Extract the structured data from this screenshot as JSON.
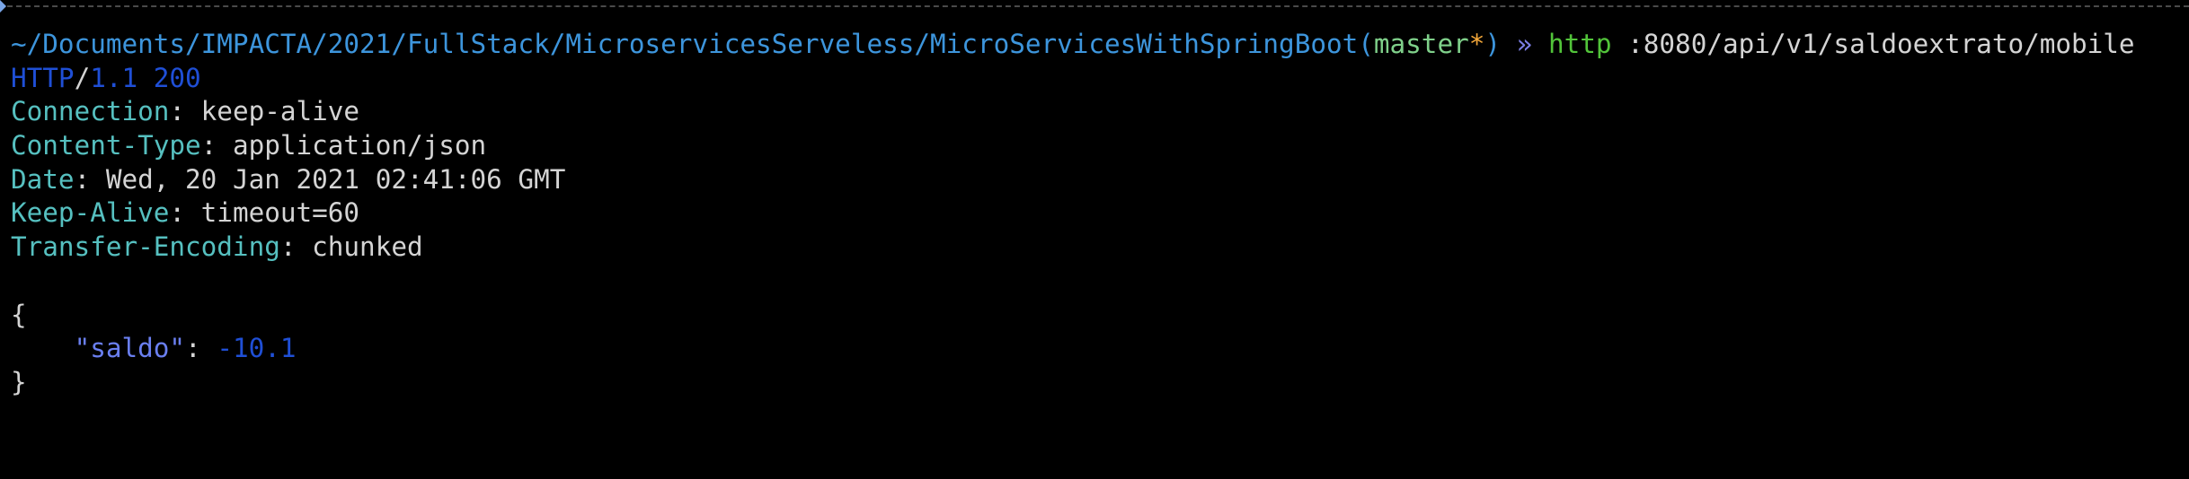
{
  "prompt": {
    "path": "~/Documents/IMPACTA/2021/FullStack/MicroservicesServeless/MicroServicesWithSpringBoot",
    "branch": "master",
    "dirty_marker": "*",
    "arrow": "»",
    "command": "http",
    "args": ":8080/api/v1/saldoextrato/mobile"
  },
  "response": {
    "protocol": "HTTP",
    "version_status": "1.1 200",
    "headers": [
      {
        "name": "Connection",
        "value": "keep-alive"
      },
      {
        "name": "Content-Type",
        "value": "application/json"
      },
      {
        "name": "Date",
        "value": "Wed, 20 Jan 2021 02:41:06 GMT"
      },
      {
        "name": "Keep-Alive",
        "value": "timeout=60"
      },
      {
        "name": "Transfer-Encoding",
        "value": "chunked"
      }
    ],
    "body": {
      "open": "{",
      "key": "\"saldo\"",
      "value": "-10.1",
      "close": "}"
    }
  }
}
